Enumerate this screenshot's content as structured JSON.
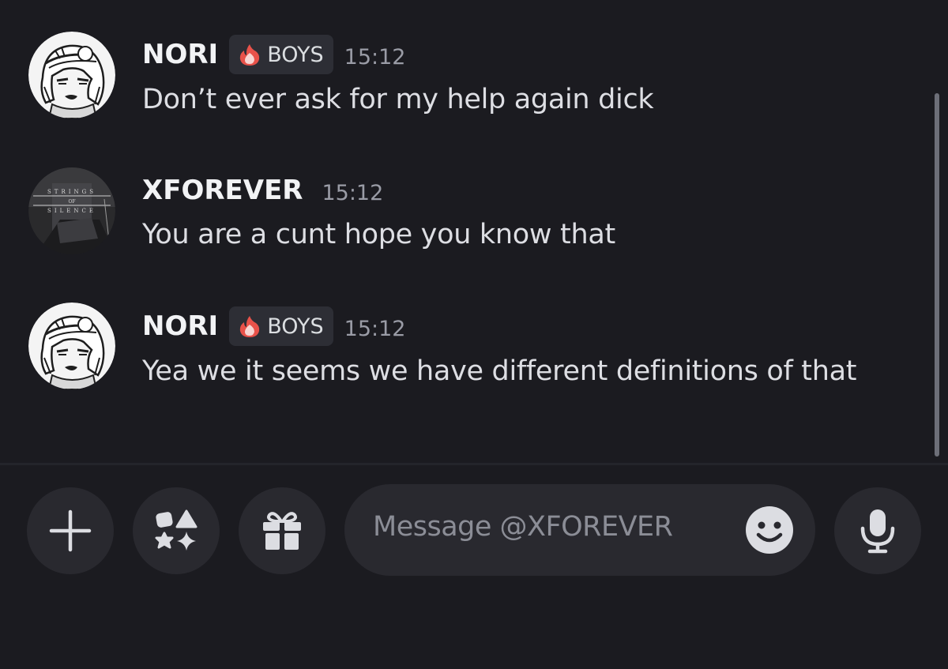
{
  "messages": [
    {
      "username": "NORI",
      "tag": "BOYS",
      "time": "15:12",
      "text": "Don’t ever ask for my help again dick"
    },
    {
      "username": "XFOREVER",
      "time": "15:12",
      "text": "You are a cunt hope you know that"
    },
    {
      "username": "NORI",
      "tag": "BOYS",
      "time": "15:12",
      "text": "Yea we it seems we have different definitions of that"
    }
  ],
  "composer": {
    "placeholder": "Message @XFOREVER",
    "icons": [
      "plus-icon",
      "apps-icon",
      "gift-icon",
      "emoji-icon",
      "microphone-icon"
    ]
  },
  "colors": {
    "background": "#1b1b20",
    "input": "#29292f",
    "tag_bg": "#2d2e35",
    "timestamp": "#9a9ca6"
  }
}
